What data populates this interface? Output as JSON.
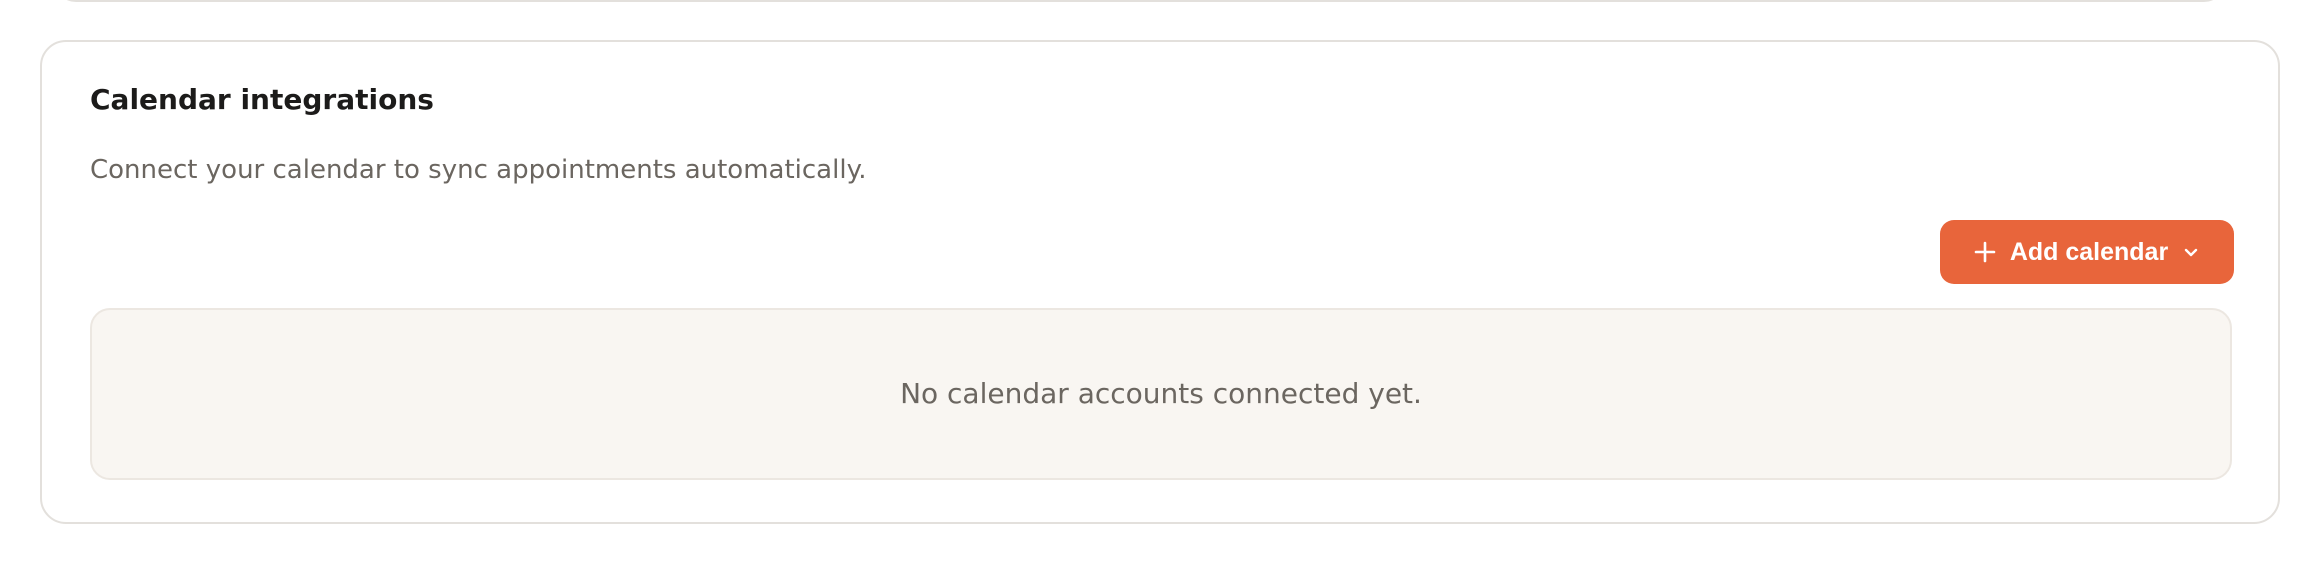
{
  "section": {
    "title": "Calendar integrations",
    "description": "Connect your calendar to sync appointments automatically."
  },
  "actions": {
    "add_calendar_label": "Add calendar",
    "add_icon": "plus-icon",
    "dropdown_icon": "chevron-down-icon"
  },
  "empty_state": {
    "message": "No calendar accounts connected yet."
  },
  "colors": {
    "accent": "#e8653b",
    "empty_panel_bg": "#f9f6f2",
    "border": "#e3e0dc",
    "title_text": "#1c1b1a",
    "muted_text": "#6b6660"
  }
}
